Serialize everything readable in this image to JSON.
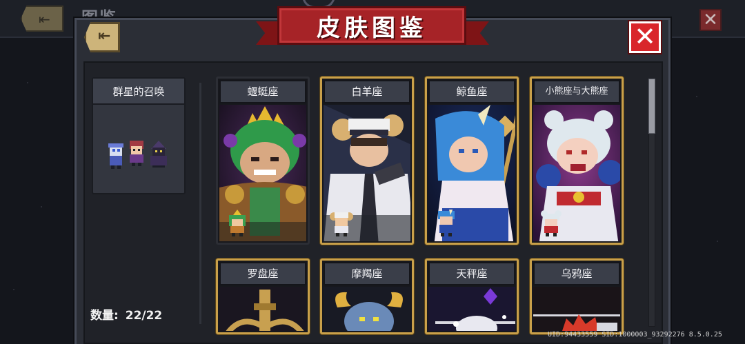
{
  "background": {
    "screen_title": "图鉴",
    "back_icon": "back-arrow-icon",
    "close_icon": "close-icon"
  },
  "dialog": {
    "title": "皮肤图鉴",
    "back_icon": "back-arrow-icon",
    "close_icon": "close-icon",
    "close_glyph": "✕"
  },
  "sidebar": {
    "category": "群星的召唤",
    "count_label": "数量:",
    "count_value": "22/22"
  },
  "skins": [
    {
      "name": "蝘蜓座",
      "frame": "plain"
    },
    {
      "name": "白羊座",
      "frame": "gold"
    },
    {
      "name": "鲸鱼座",
      "frame": "gold"
    },
    {
      "name": "小熊座与大熊座",
      "frame": "gold"
    },
    {
      "name": "罗盘座",
      "frame": "gold"
    },
    {
      "name": "摩羯座",
      "frame": "gold"
    },
    {
      "name": "天秤座",
      "frame": "gold"
    },
    {
      "name": "乌鸦座",
      "frame": "gold"
    }
  ],
  "footer": {
    "uid_text": "UID:94433559 SID:1000003_93292276 8.5.0.25"
  },
  "colors": {
    "banner_red": "#a62327",
    "gold_frame": "#c9a04a",
    "close_red": "#d9262b"
  }
}
